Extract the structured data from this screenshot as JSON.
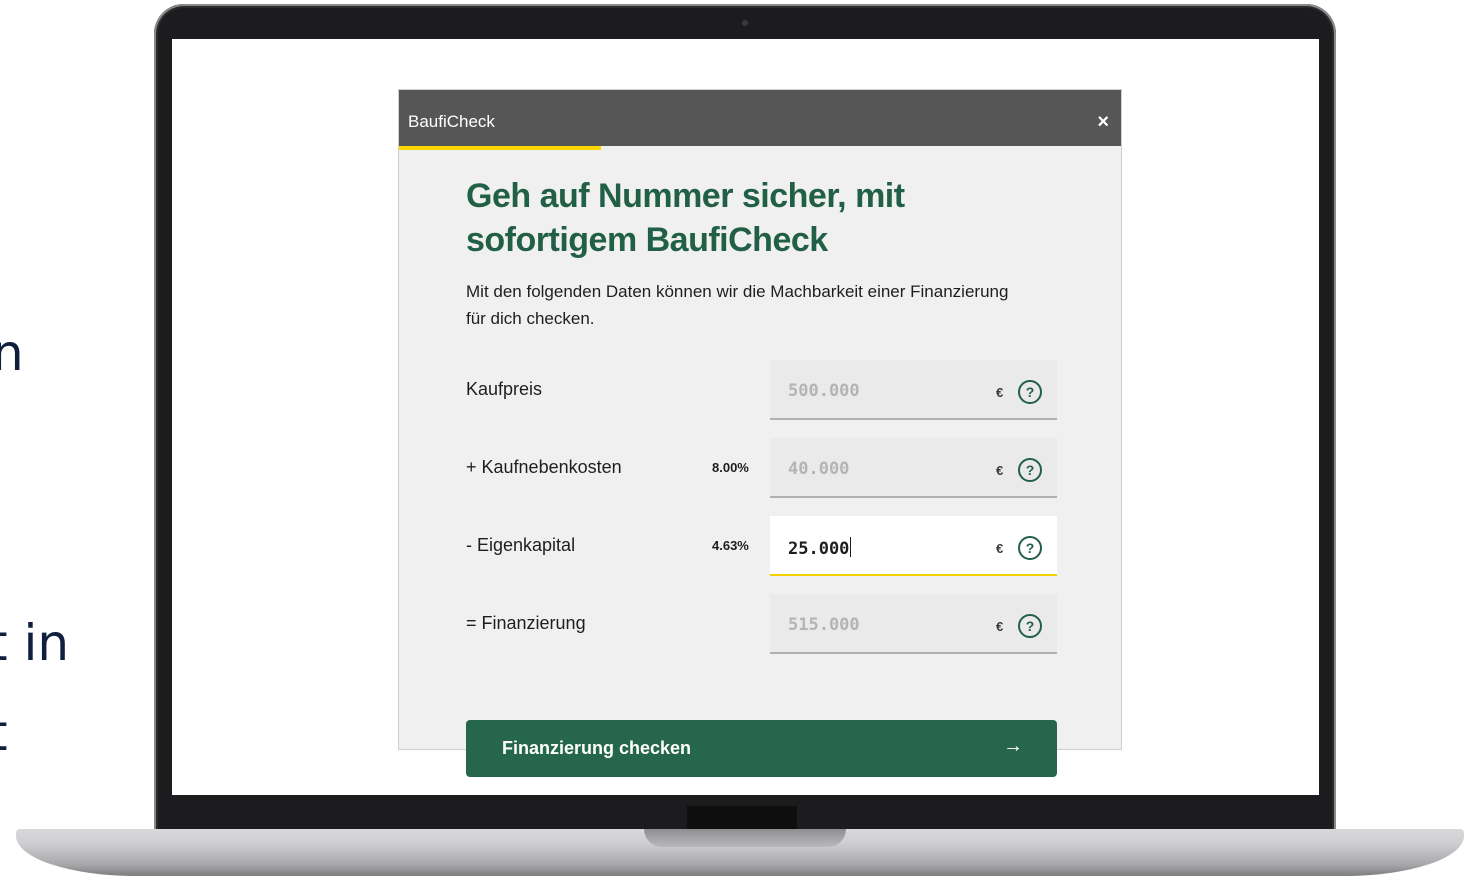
{
  "background": {
    "fragments": [
      "n",
      "t in",
      "t"
    ]
  },
  "modal": {
    "title": "BaufiCheck",
    "close_glyph": "×",
    "progress_fraction": 0.28,
    "heading": "Geh auf Nummer sicher, mit sofortigem BaufiCheck",
    "intro": "Mit den folgenden Daten können wir die Machbarkeit einer Finanzierung für dich checken.",
    "rows": [
      {
        "label": "Kaufpreis",
        "percent": "",
        "value": "500.000",
        "currency": "€",
        "help": "?"
      },
      {
        "label": "+ Kaufnebenkosten",
        "percent": "8.00%",
        "value": "40.000",
        "currency": "€",
        "help": "?"
      },
      {
        "label": "- Eigenkapital",
        "percent": "4.63%",
        "value": "25.000",
        "currency": "€",
        "help": "?"
      },
      {
        "label": "= Finanzierung",
        "percent": "",
        "value": "515.000",
        "currency": "€",
        "help": "?"
      }
    ],
    "cta": {
      "label": "Finanzierung checken",
      "arrow": "→"
    }
  },
  "colors": {
    "brand_green": "#216046",
    "accent_yellow": "#ffd700",
    "header_gray": "#565656"
  }
}
